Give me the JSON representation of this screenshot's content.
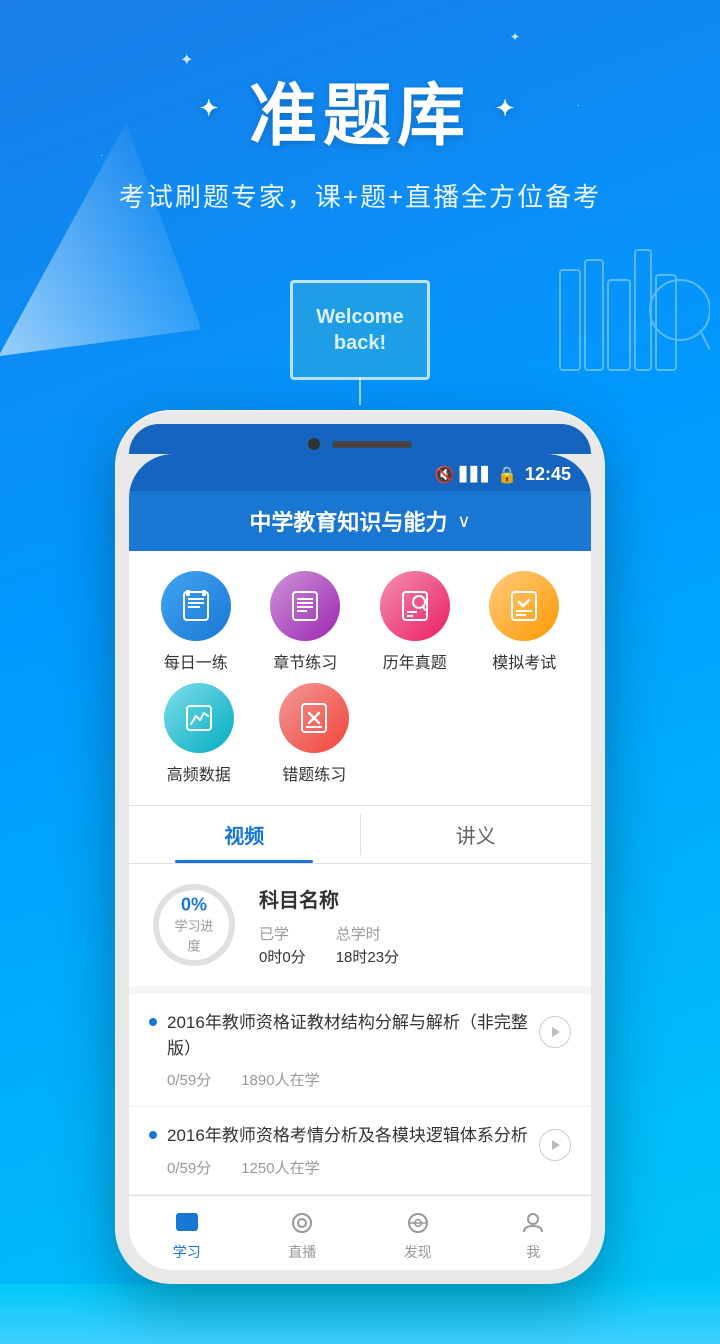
{
  "hero": {
    "title": "准题库",
    "subtitle": "考试刷题专家，课+题+直播全方位备考",
    "chalkboard": "Welcome back!",
    "title_star_left": "✦",
    "title_star_right": "✦"
  },
  "phone": {
    "status": {
      "time": "12:45"
    },
    "nav_title": "中学教育知识与能力",
    "nav_arrow": "∨"
  },
  "icon_grid": {
    "row1": [
      {
        "id": "daily",
        "label": "每日一练",
        "color": "ic-blue"
      },
      {
        "id": "chapter",
        "label": "章节练习",
        "color": "ic-purple"
      },
      {
        "id": "real",
        "label": "历年真题",
        "color": "ic-pink"
      },
      {
        "id": "mock",
        "label": "模拟考试",
        "color": "ic-orange"
      }
    ],
    "row2": [
      {
        "id": "highfreq",
        "label": "高频数据",
        "color": "ic-teal"
      },
      {
        "id": "wrong",
        "label": "错题练习",
        "color": "ic-red"
      }
    ]
  },
  "tabs": [
    {
      "id": "video",
      "label": "视频",
      "active": true
    },
    {
      "id": "lecture",
      "label": "讲义",
      "active": false
    }
  ],
  "progress": {
    "percent": "0%",
    "label": "学习进度",
    "subject": "科目名称",
    "studied_label": "已学",
    "studied_value": "0时0分",
    "total_label": "总学时",
    "total_value": "18时23分"
  },
  "courses": [
    {
      "title": "2016年教师资格证教材结构分解与解析（非完整版）",
      "score": "0/59分",
      "students": "1890人在学"
    },
    {
      "title": "2016年教师资格考情分析及各模块逻辑体系分析",
      "score": "0/59分",
      "students": "1250人在学"
    }
  ],
  "bottom_nav": [
    {
      "id": "study",
      "label": "学习",
      "active": true
    },
    {
      "id": "live",
      "label": "直播",
      "active": false
    },
    {
      "id": "discover",
      "label": "发现",
      "active": false
    },
    {
      "id": "me",
      "label": "我",
      "active": false
    }
  ]
}
